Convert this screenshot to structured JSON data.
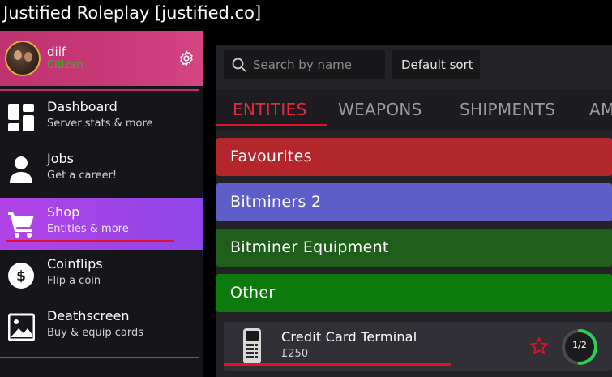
{
  "window": {
    "title": "Justified Roleplay [justified.co]"
  },
  "profile": {
    "name": "dilf",
    "rank": "Citizen",
    "rank_color": "#3fae2a"
  },
  "sidebar": {
    "items": [
      {
        "label": "Dashboard",
        "sub": "Server stats & more",
        "icon": "dashboard-icon"
      },
      {
        "label": "Jobs",
        "sub": "Get a career!",
        "icon": "person-icon"
      },
      {
        "label": "Shop",
        "sub": "Entities & more",
        "icon": "cart-icon",
        "active": true
      },
      {
        "label": "Coinflips",
        "sub": "Flip a coin",
        "icon": "dollar-icon"
      },
      {
        "label": "Deathscreen",
        "sub": "Buy & equip cards",
        "icon": "image-icon"
      }
    ]
  },
  "toolbar": {
    "search_placeholder": "Search by name",
    "sort_label": "Default sort"
  },
  "tabs": [
    "ENTITIES",
    "WEAPONS",
    "SHIPMENTS",
    "AM"
  ],
  "categories": [
    {
      "label": "Favourites",
      "color": "#b3262c"
    },
    {
      "label": "Bitminers 2",
      "color": "#5e5ec9"
    },
    {
      "label": "Bitminer Equipment",
      "color": "#1f5e1b"
    },
    {
      "label": "Other",
      "color": "#0d7a0d"
    }
  ],
  "item": {
    "name": "Credit Card Terminal",
    "price": "£250",
    "stock": "1/2",
    "stock_fraction": 0.5
  },
  "colors": {
    "accent": "#e0122a",
    "profile": "#c93a79",
    "active_nav": "#9a45e8"
  }
}
